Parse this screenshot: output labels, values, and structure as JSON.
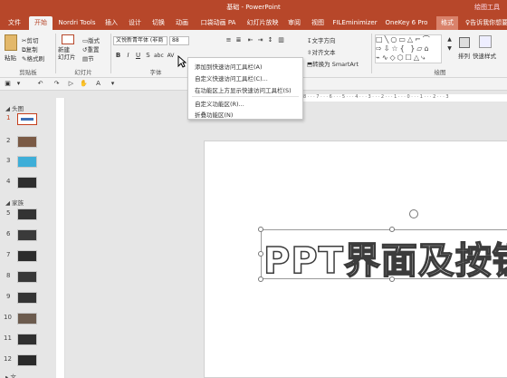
{
  "window": {
    "title": "基础 - PowerPoint",
    "context_label": "绘图工具"
  },
  "tabs": [
    {
      "label": "文件"
    },
    {
      "label": "开始"
    },
    {
      "label": "Nordri Tools"
    },
    {
      "label": "插入"
    },
    {
      "label": "设计"
    },
    {
      "label": "切换"
    },
    {
      "label": "动画"
    },
    {
      "label": "口袋动画 PA"
    },
    {
      "label": "幻灯片放映"
    },
    {
      "label": "审阅"
    },
    {
      "label": "视图"
    },
    {
      "label": "FILEminimizer"
    },
    {
      "label": "OneKey 6 Pro"
    },
    {
      "label": "格式"
    },
    {
      "label": "告诉我你想要"
    }
  ],
  "ribbon": {
    "clipboard": {
      "paste": "粘贴",
      "cut": "剪切",
      "copy": "复制",
      "format_painter": "格式刷",
      "label": "剪贴板"
    },
    "slides": {
      "new_slide": "新建\n幻灯片",
      "layout": "版式",
      "reset": "重置",
      "section": "节",
      "label": "幻灯片"
    },
    "font": {
      "name": "文悦新青年体 (非商",
      "size": "88",
      "label": "字体"
    },
    "paragraph": {
      "text_direction": "文字方向",
      "align_text": "对齐文本",
      "smartart": "转换为 SmartArt"
    },
    "drawing": {
      "arrange": "排列",
      "quick_styles": "快速样式",
      "label": "绘图"
    }
  },
  "context_menu": {
    "items": [
      {
        "label": "添加到快速访问工具栏(A)"
      },
      {
        "label": "自定义快速访问工具栏(C)..."
      },
      {
        "label": "在功能区上方显示快速访问工具栏(S)"
      },
      {
        "label": "自定义功能区(R)..."
      },
      {
        "label": "折叠功能区(N)"
      }
    ]
  },
  "slide_panel": {
    "sections": [
      {
        "label": "头图"
      },
      {
        "label": "家族"
      }
    ],
    "slides": [
      {
        "num": "1",
        "selected": true
      },
      {
        "num": "2"
      },
      {
        "num": "3"
      },
      {
        "num": "4"
      },
      {
        "num": "5"
      },
      {
        "num": "6"
      },
      {
        "num": "7"
      },
      {
        "num": "8"
      },
      {
        "num": "9"
      },
      {
        "num": "10"
      },
      {
        "num": "11"
      },
      {
        "num": "12"
      }
    ],
    "footer": "文"
  },
  "ruler": {
    "ticks": "8 · · · 7 · · · 6 · · · 5 · · · 4 · · · 3 · · · 2 · · · 1 · · · 0 · · · 1 · · · 2 · · · 3"
  },
  "slide": {
    "title": "PPT界面及按钮认"
  },
  "colors": {
    "brand": "#b7472a",
    "selected_border": "#c43e1c"
  }
}
